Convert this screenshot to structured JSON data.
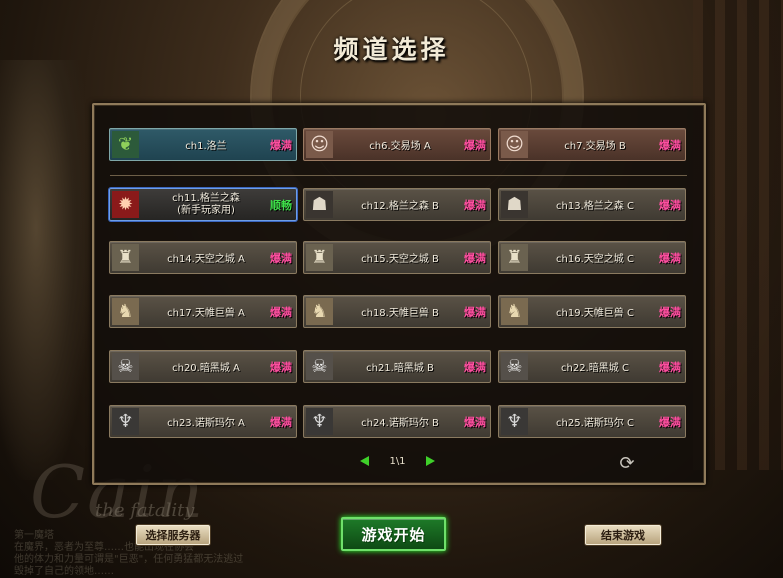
{
  "title": "频道选择",
  "background": {
    "logo_text": "Cain",
    "logo_sub": "the fatality",
    "lore_text": "第一魔塔\n在魔界，恶者为至尊……也能出现在协会\n他的体力和力量可谓是\"巨恶\"，任何勇猛都无法逃过\n毁掉了自己的领地……"
  },
  "colors": {
    "status_hot": "#ff4fa0",
    "status_ok": "#3fe04a",
    "selected_border": "#6e9ee8",
    "start_button": "#1e7a28"
  },
  "channels": [
    {
      "name": "ch1.洛兰",
      "status": "爆满",
      "icon": "leaf-icon",
      "glyph": "❦"
    },
    {
      "name": "ch6.交易场 A",
      "status": "爆满",
      "icon": "merchant-icon",
      "glyph": "☺"
    },
    {
      "name": "ch7.交易场 B",
      "status": "爆满",
      "icon": "merchant-icon",
      "glyph": "☺"
    },
    {
      "name": "ch11.格兰之森",
      "name2": "(新手玩家用)",
      "status": "顺畅",
      "icon": "red-creature-icon",
      "glyph": "✹"
    },
    {
      "name": "ch12.格兰之森 B",
      "status": "爆满",
      "icon": "beast-icon",
      "glyph": "☗"
    },
    {
      "name": "ch13.格兰之森 C",
      "status": "爆满",
      "icon": "beast-icon",
      "glyph": "☗"
    },
    {
      "name": "ch14.天空之城 A",
      "status": "爆满",
      "icon": "golem-icon",
      "glyph": "♜"
    },
    {
      "name": "ch15.天空之城 B",
      "status": "爆满",
      "icon": "golem-icon",
      "glyph": "♜"
    },
    {
      "name": "ch16.天空之城 C",
      "status": "爆满",
      "icon": "golem-icon",
      "glyph": "♜"
    },
    {
      "name": "ch17.天帷巨兽 A",
      "status": "爆满",
      "icon": "giant-beast-icon",
      "glyph": "♞"
    },
    {
      "name": "ch18.天帷巨兽 B",
      "status": "爆满",
      "icon": "giant-beast-icon",
      "glyph": "♞"
    },
    {
      "name": "ch19.天帷巨兽 C",
      "status": "爆满",
      "icon": "giant-beast-icon",
      "glyph": "♞"
    },
    {
      "name": "ch20.暗黑城 A",
      "status": "爆满",
      "icon": "demon-icon",
      "glyph": "☠"
    },
    {
      "name": "ch21.暗黑城 B",
      "status": "爆满",
      "icon": "demon-icon",
      "glyph": "☠"
    },
    {
      "name": "ch22.暗黑城 C",
      "status": "爆满",
      "icon": "demon-icon",
      "glyph": "☠"
    },
    {
      "name": "ch23.诺斯玛尔 A",
      "status": "爆满",
      "icon": "reaper-icon",
      "glyph": "♆"
    },
    {
      "name": "ch24.诺斯玛尔 B",
      "status": "爆满",
      "icon": "reaper-icon",
      "glyph": "♆"
    },
    {
      "name": "ch25.诺斯玛尔 C",
      "status": "爆满",
      "icon": "reaper-icon",
      "glyph": "♆"
    }
  ],
  "selected_channel": "ch11.格兰之森",
  "pager": {
    "text": "1\\1"
  },
  "buttons": {
    "server_select": "选择服务器",
    "start_game": "游戏开始",
    "exit_game": "结束游戏"
  }
}
